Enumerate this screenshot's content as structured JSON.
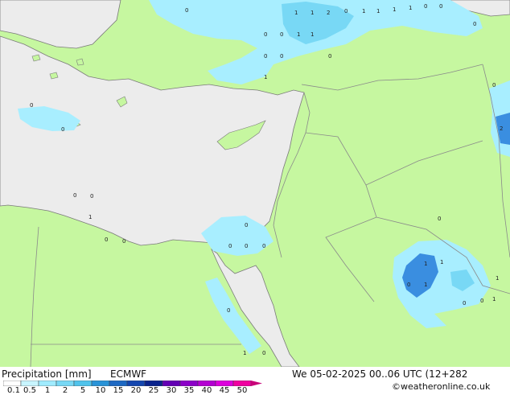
{
  "legend": {
    "title": "Precipitation [mm]",
    "model": "ECMWF",
    "ticks": [
      "0.1",
      "0.5",
      "1",
      "2",
      "5",
      "10",
      "15",
      "20",
      "25",
      "30",
      "35",
      "40",
      "45",
      "50"
    ],
    "colors": [
      "#ffffff",
      "#c8f5ff",
      "#a0ebff",
      "#78d8f5",
      "#50c3eb",
      "#2893d7",
      "#1e69c3",
      "#1446af",
      "#0a238c",
      "#6400b4",
      "#8c00c8",
      "#b400d2",
      "#dc00dc",
      "#f000a0",
      "#c80078"
    ]
  },
  "validity": "We 05-02-2025 00..06 UTC (12+282",
  "credit": "©weatheronline.co.uk",
  "colors": {
    "land": "#c6f7a0",
    "sea": "#ececec",
    "border": "#8a8a8a",
    "coast": "#7a7a7a",
    "precip_light": "#a8eeff",
    "precip_mid": "#78d8f5",
    "precip_heavy": "#3a8ee0"
  },
  "station_values": [
    "1",
    "1",
    "2",
    "0",
    "1",
    "1",
    "1",
    "1",
    "0",
    "0",
    "0",
    "1",
    "1",
    "0",
    "0",
    "0",
    "0",
    "0",
    "2",
    "0",
    "0",
    "1",
    "0",
    "0",
    "0",
    "0",
    "1",
    "1",
    "1",
    "1",
    "0",
    "0",
    "0",
    "1",
    "1",
    "0",
    "0",
    "0",
    "0",
    "0",
    "0",
    "0",
    "0",
    "1",
    "0"
  ]
}
